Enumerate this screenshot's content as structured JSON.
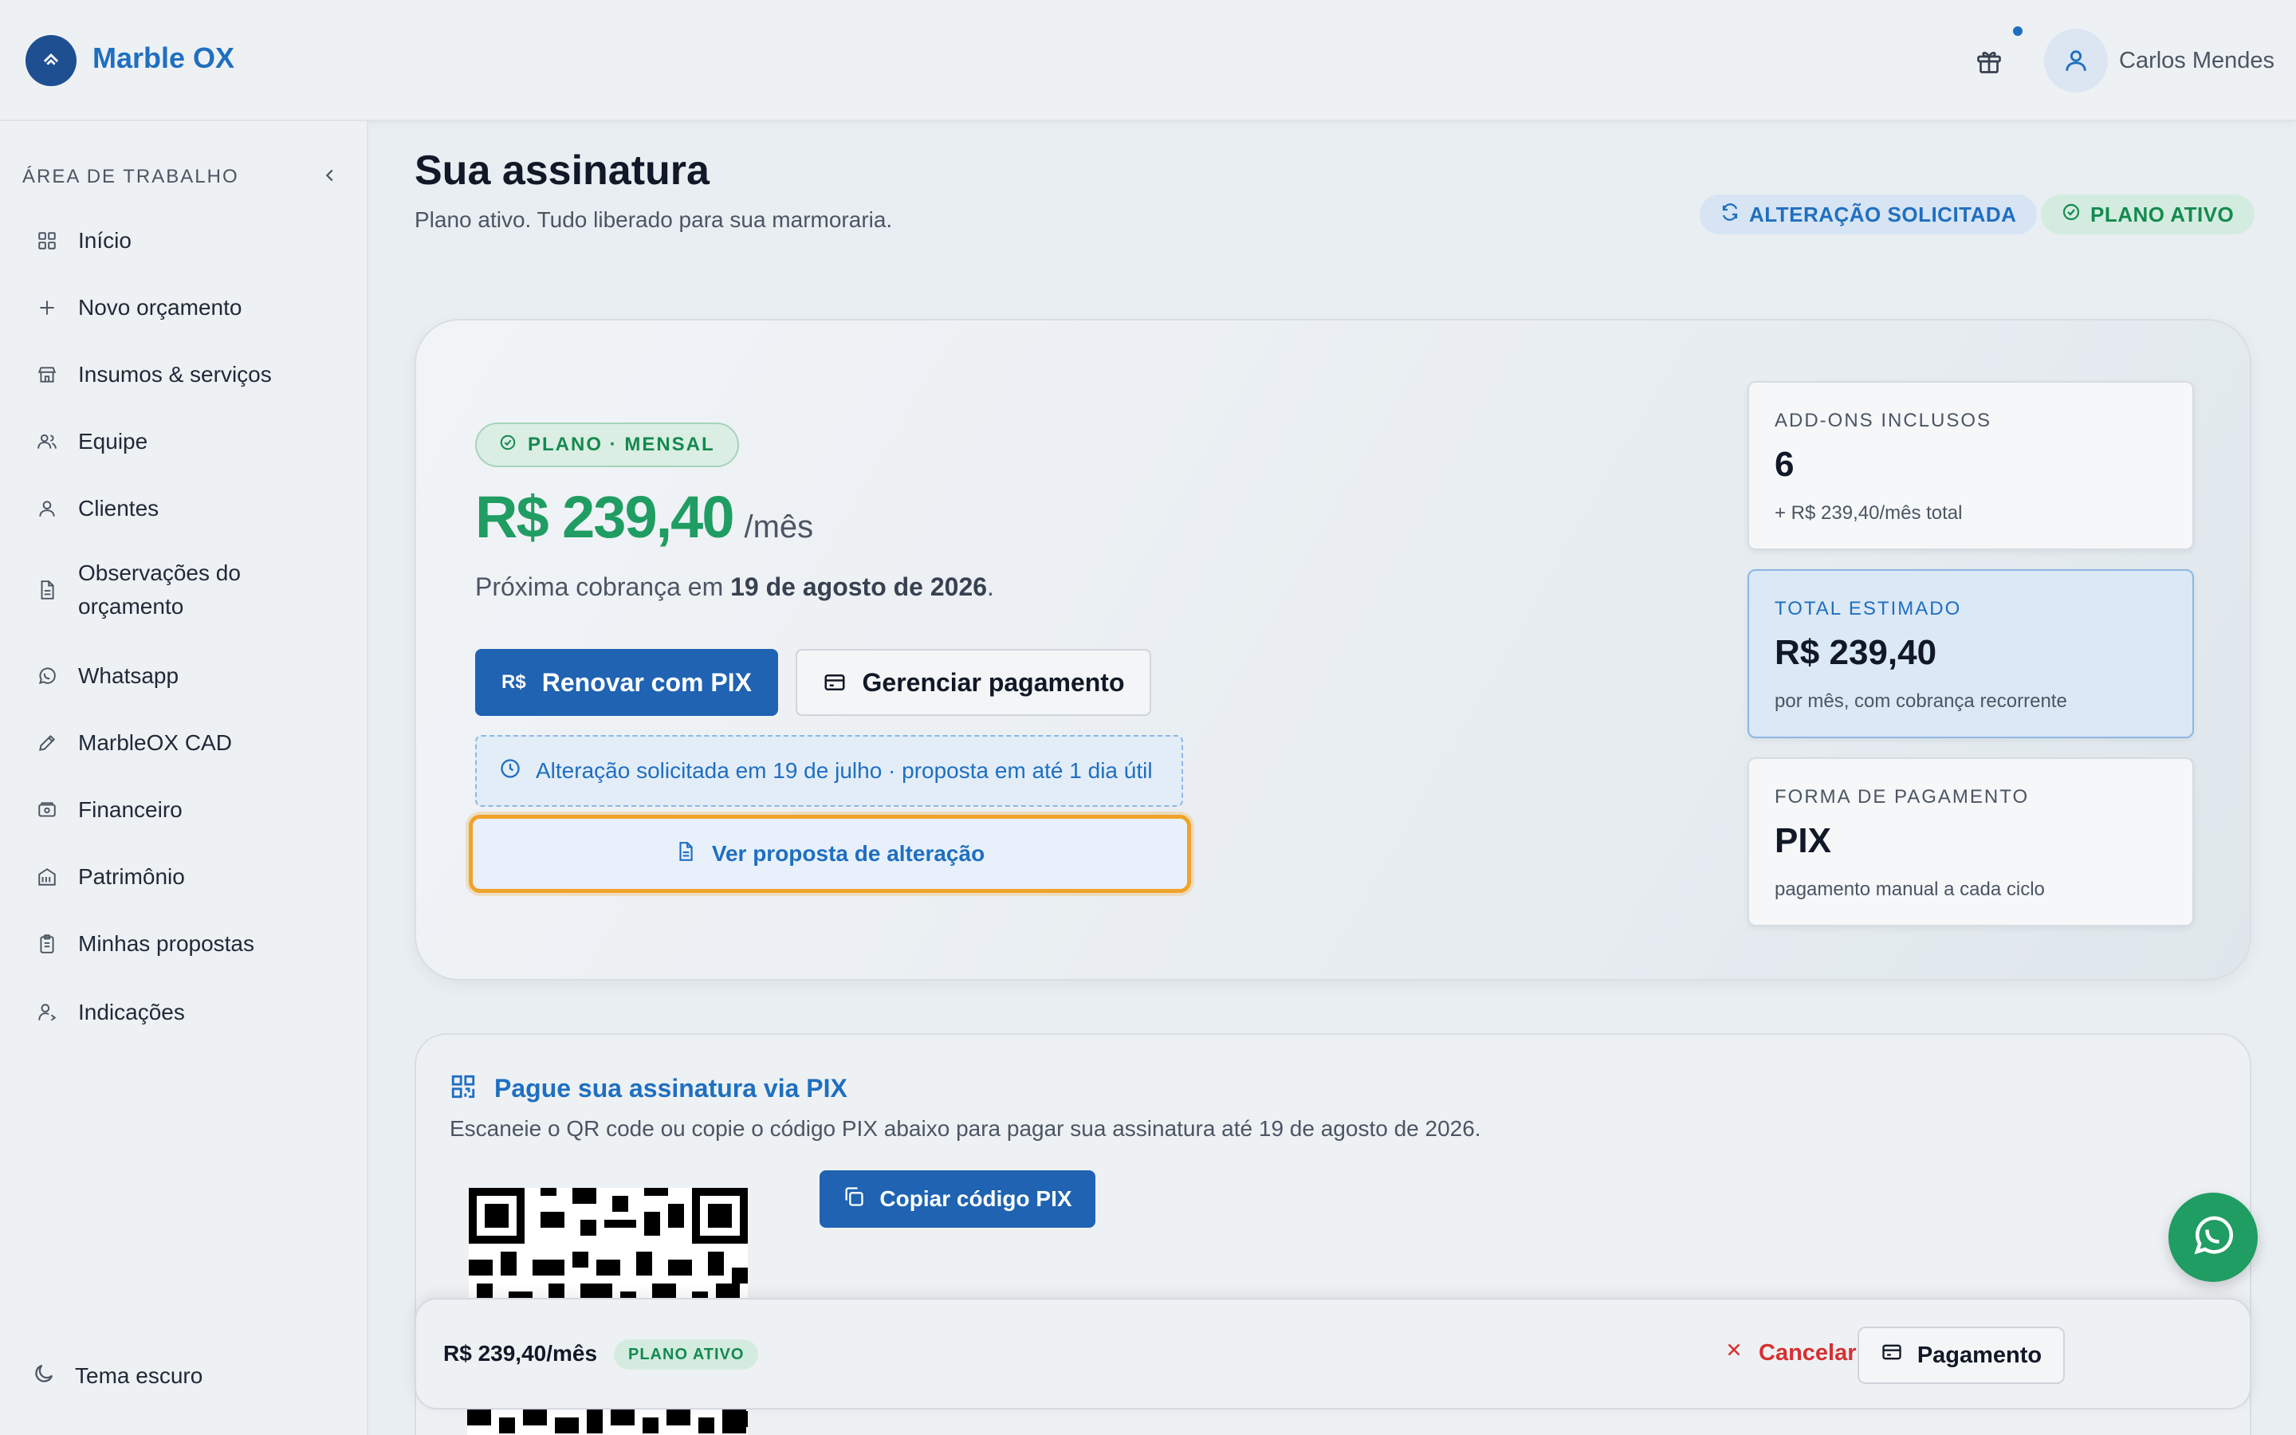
{
  "app": {
    "brand": "Marble OX",
    "user_name": "Carlos Mendes"
  },
  "sidebar": {
    "title": "ÁREA DE TRABALHO",
    "items": [
      {
        "label": "Início",
        "icon": "grid-icon"
      },
      {
        "label": "Novo orçamento",
        "icon": "plus-icon"
      },
      {
        "label": "Insumos & serviços",
        "icon": "store-icon"
      },
      {
        "label": "Equipe",
        "icon": "users-icon"
      },
      {
        "label": "Clientes",
        "icon": "user-icon"
      },
      {
        "label": "Observações do orçamento",
        "icon": "document-icon"
      },
      {
        "label": "Whatsapp",
        "icon": "whatsapp-icon"
      },
      {
        "label": "MarbleOX CAD",
        "icon": "pencil-icon"
      },
      {
        "label": "Financeiro",
        "icon": "wallet-icon"
      },
      {
        "label": "Patrimônio",
        "icon": "building-icon"
      },
      {
        "label": "Minhas propostas",
        "icon": "clipboard-icon"
      },
      {
        "label": "Indicações",
        "icon": "user-share-icon"
      }
    ],
    "theme_label": "Tema escuro"
  },
  "page": {
    "title": "Sua assinatura",
    "subtitle": "Plano ativo. Tudo liberado para sua marmoraria.",
    "pill_change": "ALTERAÇÃO SOLICITADA",
    "pill_active": "PLANO ATIVO"
  },
  "plan": {
    "badge": "PLANO · MENSAL",
    "price": "R$ 239,40",
    "period": "/mês",
    "next_prefix": "Próxima cobrança em ",
    "next_date": "19 de agosto de 2026",
    "next_suffix": ".",
    "renew_currency": "R$",
    "renew_label": "Renovar com PIX",
    "manage_label": "Gerenciar pagamento",
    "notice": "Alteração solicitada em 19 de julho · proposta em até 1 dia útil",
    "proposal_label": "Ver proposta de alteração"
  },
  "stats": [
    {
      "label": "ADD-ONS INCLUSOS",
      "value": "6",
      "sub": "+ R$ 239,40/mês total"
    },
    {
      "label": "TOTAL ESTIMADO",
      "value": "R$ 239,40",
      "sub": "por mês, com cobrança recorrente"
    },
    {
      "label": "FORMA DE PAGAMENTO",
      "value": "PIX",
      "sub": "pagamento manual a cada ciclo"
    }
  ],
  "pix": {
    "title": "Pague sua assinatura via PIX",
    "description": "Escaneie o QR code ou copie o código PIX abaixo para pagar sua assinatura até 19 de agosto de 2026.",
    "copy_label": "Copiar código PIX"
  },
  "footer": {
    "price": "R$ 239,40/mês",
    "badge": "PLANO ATIVO",
    "cancel_label": "Cancelar Assinatura",
    "pay_label": "Pagamento"
  },
  "colors": {
    "primary": "#1f63b2",
    "accent_green": "#1f9d62",
    "danger": "#d63031",
    "highlight": "#f0a22a"
  }
}
